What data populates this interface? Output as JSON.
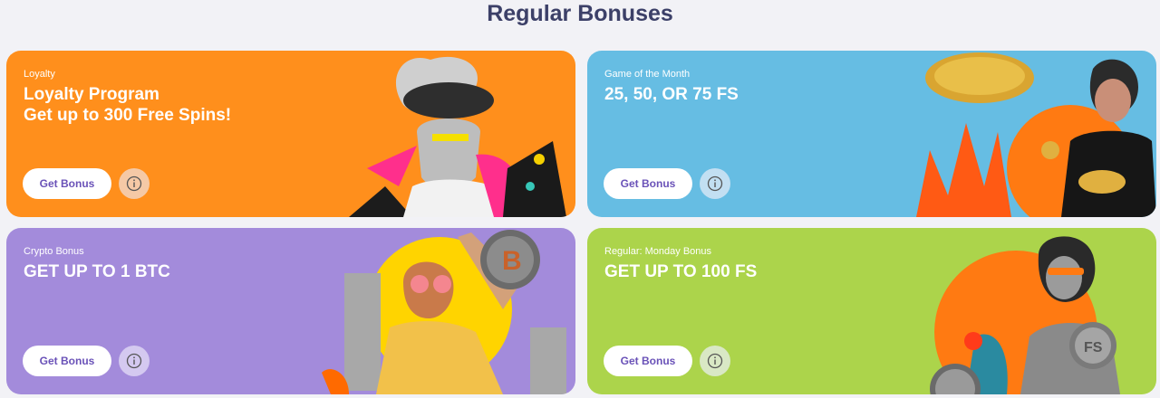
{
  "section": {
    "title": "Regular Bonuses"
  },
  "cards": [
    {
      "tag": "Loyalty",
      "headline": [
        "Loyalty Program",
        "Get up to 300 Free Spins!"
      ],
      "button_label": "Get Bonus",
      "bg": "#ff8f1c"
    },
    {
      "tag": "Game of the Month",
      "headline": [
        "25, 50, OR 75 FS"
      ],
      "button_label": "Get Bonus",
      "bg": "#66bde3"
    },
    {
      "tag": "Crypto Bonus",
      "headline": [
        "GET UP TO 1 BTC"
      ],
      "button_label": "Get Bonus",
      "bg": "#a38bdb"
    },
    {
      "tag": "Regular: Monday Bonus",
      "headline": [
        "GET UP TO 100 FS"
      ],
      "button_label": "Get Bonus",
      "bg": "#acd44b"
    }
  ],
  "colors": {
    "title": "#3c4068",
    "button_text": "#6a52b8"
  },
  "icons": {
    "info": "info-icon",
    "coin_btc": "btc-coin-icon",
    "coin_fs": "fs-coin-icon"
  }
}
